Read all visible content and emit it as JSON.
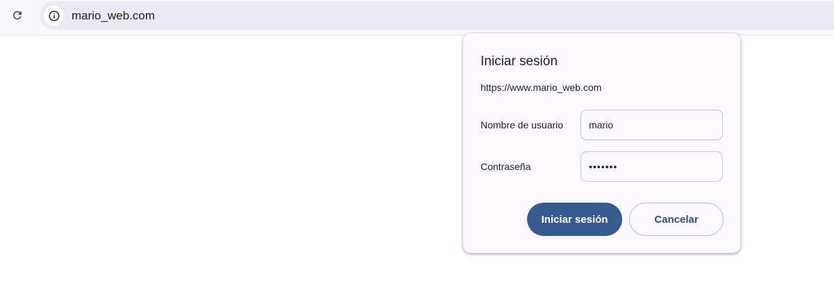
{
  "toolbar": {
    "reload_icon": "reload-icon",
    "site_info_icon": "info-circle-icon",
    "url": "mario_web.com"
  },
  "dialog": {
    "title": "Iniciar sesión",
    "origin": "https://www.mario_web.com",
    "username_label": "Nombre de usuario",
    "username_value": "mario",
    "password_label": "Contraseña",
    "password_value": "•••••••",
    "submit_label": "Iniciar sesión",
    "cancel_label": "Cancelar"
  },
  "colors": {
    "primary_button": "#365b91",
    "secondary_button_text": "#2f4f82",
    "secondary_button_border": "#a9c4ec",
    "dialog_background": "#fbf8fe",
    "omnibox_background": "#e8eaf4"
  }
}
